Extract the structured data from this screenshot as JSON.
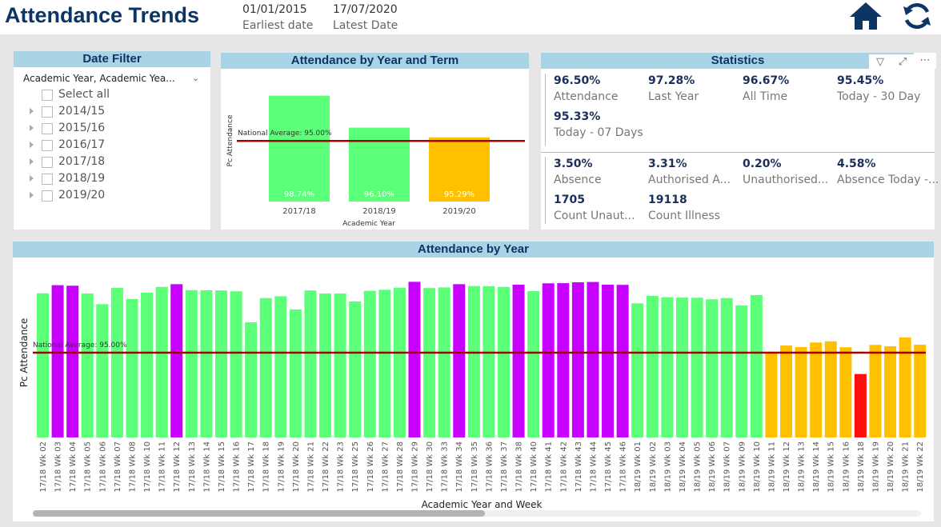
{
  "header": {
    "title": "Attendance Trends",
    "earliest_date": "01/01/2015",
    "earliest_label": "Earliest date",
    "latest_date": "17/07/2020",
    "latest_label": "Latest Date",
    "icons": [
      "home-icon",
      "refresh-icon"
    ]
  },
  "colors": {
    "title": "#0c3564",
    "panel_header": "#a8d4e6",
    "green": "#5cff78",
    "purple": "#c800ff",
    "orange": "#ffc000",
    "red": "#ff0d0d",
    "avg_line": "#a00000"
  },
  "date_filter": {
    "title": "Date Filter",
    "dropdown": "Academic Year, Academic Yea...",
    "select_all": "Select all",
    "items": [
      "2014/15",
      "2015/16",
      "2016/17",
      "2017/18",
      "2018/19",
      "2019/20"
    ]
  },
  "statistics": {
    "title": "Statistics",
    "group1": [
      {
        "value": "96.50%",
        "label": "Attendance"
      },
      {
        "value": "97.28%",
        "label": "Last Year"
      },
      {
        "value": "96.67%",
        "label": "All Time"
      },
      {
        "value": "95.45%",
        "label": "Today - 30 Day"
      },
      {
        "value": "95.33%",
        "label": "Today - 07 Days"
      }
    ],
    "group2": [
      {
        "value": "3.50%",
        "label": "Absence"
      },
      {
        "value": "3.31%",
        "label": "Authorised A..."
      },
      {
        "value": "0.20%",
        "label": "Unauthorised..."
      },
      {
        "value": "4.58%",
        "label": "Absence Today -..."
      },
      {
        "value": "1705",
        "label": "Count Unaut..."
      },
      {
        "value": "19118",
        "label": "Count Illness"
      }
    ]
  },
  "chart_data": [
    {
      "type": "bar",
      "title": "Attendance by Year and Term",
      "xlabel": "Academic Year",
      "ylabel": "Pc Attendance",
      "categories": [
        "2017/18",
        "2018/19",
        "2019/20"
      ],
      "values": [
        98.74,
        96.1,
        95.29
      ],
      "data_labels": [
        "98.74%",
        "96.10%",
        "95.29%"
      ],
      "colors": [
        "#5cff78",
        "#5cff78",
        "#ffc000"
      ],
      "ylim": [
        90,
        100
      ],
      "reference_line": {
        "value": 95.0,
        "label": "National Average: 95.00%"
      },
      "grid": false
    },
    {
      "type": "bar",
      "title": "Attendance by Year",
      "xlabel": "Academic Year and Week",
      "ylabel": "Pc Attendance",
      "ylim": [
        90,
        100
      ],
      "grid": false,
      "reference_line": {
        "value": 95.0,
        "label": "National Average: 95.00%"
      },
      "categories": [
        "17/18 Wk 02",
        "17/18 Wk 03",
        "17/18 Wk 04",
        "17/18 Wk 05",
        "17/18 Wk 06",
        "17/18 Wk 07",
        "17/18 Wk 08",
        "17/18 Wk 10",
        "17/18 Wk 11",
        "17/18 Wk 12",
        "17/18 Wk 13",
        "17/18 Wk 14",
        "17/18 Wk 15",
        "17/18 Wk 16",
        "17/18 Wk 17",
        "17/18 Wk 18",
        "17/18 Wk 19",
        "17/18 Wk 20",
        "17/18 Wk 21",
        "17/18 Wk 22",
        "17/18 Wk 23",
        "17/18 Wk 25",
        "17/18 Wk 26",
        "17/18 Wk 27",
        "17/18 Wk 28",
        "17/18 Wk 29",
        "17/18 Wk 30",
        "17/18 Wk 33",
        "17/18 Wk 34",
        "17/18 Wk 35",
        "17/18 Wk 36",
        "17/18 Wk 37",
        "17/18 Wk 38",
        "17/18 Wk 40",
        "17/18 Wk 41",
        "17/18 Wk 42",
        "17/18 Wk 43",
        "17/18 Wk 44",
        "17/18 Wk 45",
        "17/18 Wk 46",
        "18/19 Wk 01",
        "18/19 Wk 02",
        "18/19 Wk 03",
        "18/19 Wk 04",
        "18/19 Wk 05",
        "18/19 Wk 06",
        "18/19 Wk 07",
        "18/19 Wk 09",
        "18/19 Wk 10",
        "18/19 Wk 11",
        "18/19 Wk 12",
        "18/19 Wk 13",
        "18/19 Wk 14",
        "18/19 Wk 15",
        "18/19 Wk 16",
        "18/19 Wk 18",
        "18/19 Wk 19",
        "18/19 Wk 20",
        "18/19 Wk 21",
        "18/19 Wk 22"
      ],
      "values": [
        98.5,
        98.98,
        98.95,
        98.49,
        97.86,
        98.82,
        98.16,
        98.54,
        98.88,
        99.04,
        98.69,
        98.68,
        98.67,
        98.62,
        96.79,
        98.22,
        98.33,
        97.55,
        98.67,
        98.49,
        98.49,
        98.02,
        98.65,
        98.71,
        98.83,
        99.18,
        98.81,
        98.85,
        99.04,
        98.93,
        98.92,
        98.88,
        99.01,
        98.63,
        99.09,
        99.1,
        99.15,
        99.17,
        99.01,
        99.0,
        97.91,
        98.35,
        98.27,
        98.25,
        98.24,
        98.15,
        98.22,
        97.78,
        98.4,
        94.97,
        95.42,
        95.33,
        95.6,
        95.67,
        95.32,
        93.74,
        95.46,
        95.38,
        95.9,
        95.47
      ],
      "colors": [
        "g",
        "p",
        "p",
        "g",
        "g",
        "g",
        "g",
        "g",
        "g",
        "p",
        "g",
        "g",
        "g",
        "g",
        "g",
        "g",
        "g",
        "g",
        "g",
        "g",
        "g",
        "g",
        "g",
        "g",
        "g",
        "p",
        "g",
        "g",
        "p",
        "g",
        "g",
        "g",
        "p",
        "g",
        "p",
        "p",
        "p",
        "p",
        "p",
        "p",
        "g",
        "g",
        "g",
        "g",
        "g",
        "g",
        "g",
        "g",
        "g",
        "o",
        "o",
        "o",
        "o",
        "o",
        "o",
        "r",
        "o",
        "o",
        "o",
        "o"
      ]
    }
  ]
}
